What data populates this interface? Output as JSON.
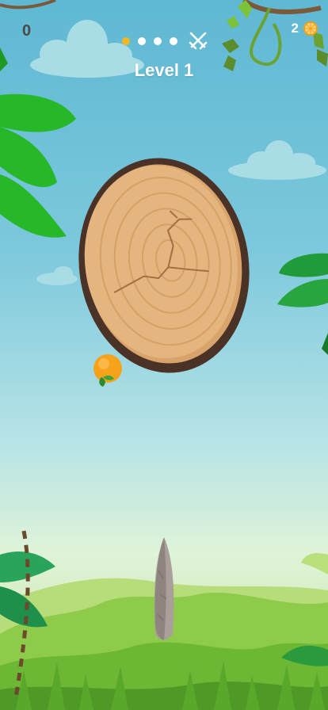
{
  "hud": {
    "score": "0",
    "level_label": "Level 1",
    "coins": "2",
    "stage_progress": {
      "total_stages": 4,
      "current_stage": 1
    }
  },
  "colors": {
    "sky_top": "#5fb8d3",
    "grass": "#7dc23d",
    "wood_face": "#e4b57f",
    "wood_bark": "#4a3326",
    "active_dot": "#f2b723",
    "orange_fruit": "#f7a21b"
  },
  "icons": {
    "boss": "crossed-swords-icon",
    "currency": "orange-slice-icon"
  },
  "game": {
    "target": "wooden-log",
    "fruit_on_log": "orange",
    "thrown_item": "stone-knife"
  }
}
